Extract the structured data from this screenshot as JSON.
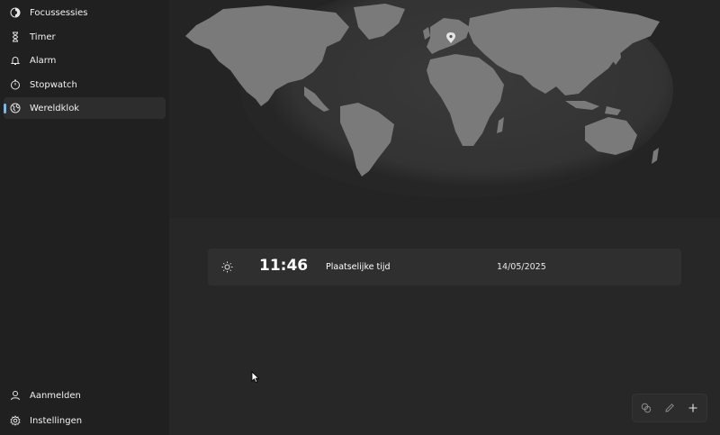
{
  "sidebar": {
    "items": [
      {
        "label": "Focussessies",
        "icon": "focus-icon"
      },
      {
        "label": "Timer",
        "icon": "hourglass-icon"
      },
      {
        "label": "Alarm",
        "icon": "bell-icon"
      },
      {
        "label": "Stopwatch",
        "icon": "stopwatch-icon"
      },
      {
        "label": "Wereldklok",
        "icon": "globe-icon",
        "selected": true
      }
    ],
    "bottom_items": [
      {
        "label": "Aanmelden",
        "icon": "person-icon"
      },
      {
        "label": "Instellingen",
        "icon": "gear-icon"
      }
    ]
  },
  "clock_card": {
    "time": "11:46",
    "label": "Plaatselijke tijd",
    "date": "14/05/2025",
    "icon": "sun-icon"
  },
  "toolbar": {
    "buttons": [
      "compare-icon",
      "edit-icon",
      "add-icon"
    ]
  },
  "colors": {
    "accent": "#76b9ed",
    "land": "#7a7a7a",
    "sidebar_bg": "#202020",
    "main_bg": "#272727",
    "card_bg": "#2f2f2f"
  }
}
